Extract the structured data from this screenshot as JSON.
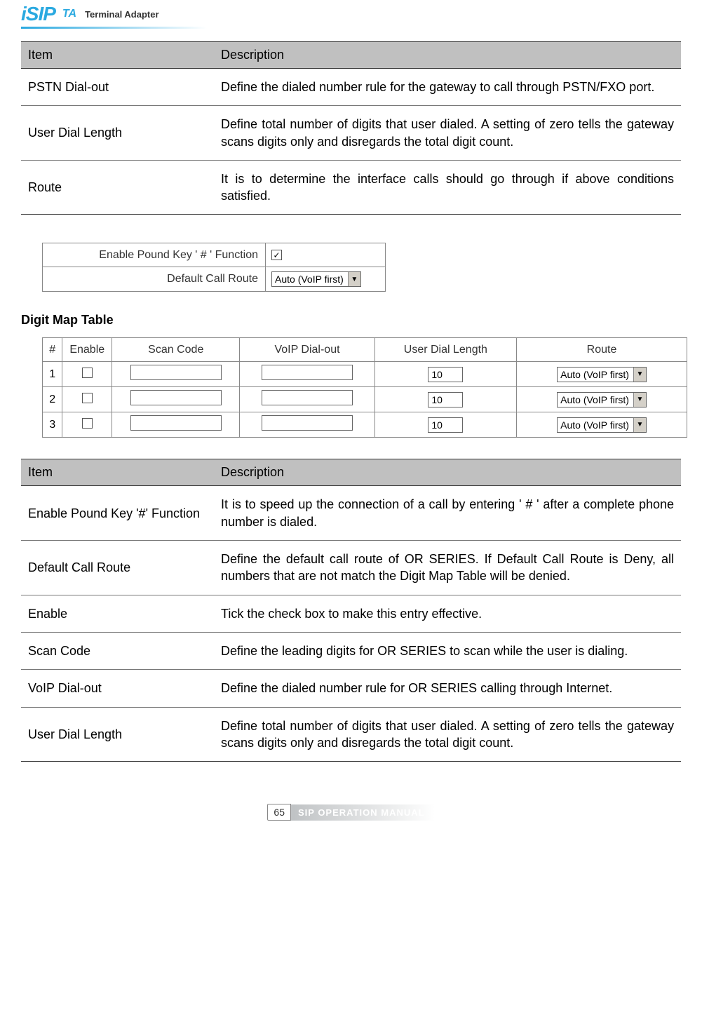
{
  "header": {
    "logo": "iSIP",
    "ta": "TA",
    "label": "Terminal Adapter"
  },
  "table1": {
    "headers": {
      "item": "Item",
      "desc": "Description"
    },
    "rows": [
      {
        "item": "PSTN Dial-out",
        "desc": "Define the dialed number rule for the gateway to call through PSTN/FXO port."
      },
      {
        "item": "User Dial Length",
        "desc": "Define total number of digits that user dialed. A setting of zero tells the gateway scans digits only and disregards the total digit count."
      },
      {
        "item": "Route",
        "desc": "It is to determine the interface calls should go through if above conditions satisfied."
      }
    ]
  },
  "settings": {
    "pound_label": "Enable Pound Key ' # ' Function",
    "pound_checked": "✓",
    "route_label": "Default Call Route",
    "route_value": "Auto (VoIP first)"
  },
  "section_title": "Digit Map Table",
  "digit_table": {
    "headers": {
      "num": "#",
      "enable": "Enable",
      "scan": "Scan Code",
      "voip": "VoIP Dial-out",
      "len": "User Dial Length",
      "route": "Route"
    },
    "rows": [
      {
        "num": "1",
        "len": "10",
        "route": "Auto (VoIP first)"
      },
      {
        "num": "2",
        "len": "10",
        "route": "Auto (VoIP first)"
      },
      {
        "num": "3",
        "len": "10",
        "route": "Auto (VoIP first)"
      }
    ]
  },
  "table2": {
    "headers": {
      "item": "Item",
      "desc": "Description"
    },
    "rows": [
      {
        "item": "Enable Pound Key '#' Function",
        "desc": "It is to speed up the connection of a call by entering ' # ' after a complete phone number is dialed."
      },
      {
        "item": "Default Call Route",
        "desc": "Define the default call route of OR SERIES. If Default Call Route is Deny, all numbers that are not match the Digit Map Table will be denied."
      },
      {
        "item": "Enable",
        "desc": "Tick the check box to make this entry effective."
      },
      {
        "item": "Scan Code",
        "desc": "Define the leading digits for OR SERIES to scan while the user is dialing."
      },
      {
        "item": "VoIP Dial-out",
        "desc": "Define the dialed number rule for OR SERIES calling through Internet."
      },
      {
        "item": "User Dial Length",
        "desc": "Define total number of digits that user dialed. A setting of zero tells the gateway scans digits only and disregards the total digit count."
      }
    ]
  },
  "footer": {
    "page": "65",
    "label": "SIP OPERATION MANUAL"
  }
}
